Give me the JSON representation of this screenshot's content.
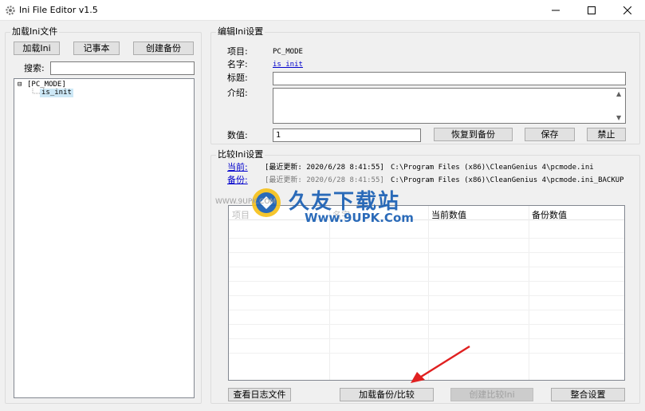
{
  "window": {
    "title": "Ini File Editor v1.5",
    "icon": "gear-icon"
  },
  "left_panel": {
    "group_title": "加载Ini文件",
    "buttons": {
      "load_ini": "加载Ini",
      "notepad": "记事本",
      "create_backup": "创建备份"
    },
    "search_label": "搜索:",
    "search_value": "",
    "tree": {
      "root": "[PC_MODE]",
      "root_toggle": "⊟",
      "child": "is_init"
    }
  },
  "edit_panel": {
    "group_title": "编辑Ini设置",
    "item_label": "项目:",
    "item_value": "PC_MODE",
    "name_label": "名字:",
    "name_value": "is_init",
    "title_label": "标题:",
    "title_value": "",
    "intro_label": "介绍:",
    "intro_value": "",
    "value_label": "数值:",
    "value_value": "1",
    "buttons": {
      "restore": "恢复到备份",
      "save": "保存",
      "disable": "禁止"
    }
  },
  "compare_panel": {
    "group_title": "比较Ini设置",
    "rows": [
      {
        "link": "当前:",
        "updated": "[最近更新: 2020/6/28 8:41:55]",
        "path": "C:\\Program Files (x86)\\CleanGenius 4\\pcmode.ini"
      },
      {
        "link": "备份:",
        "updated": "[最近更新: 2020/6/28 8:41:55]",
        "path": "C:\\Program Files (x86)\\CleanGenius 4\\pcmode.ini_BACKUP"
      }
    ],
    "grid_headers": [
      "项目",
      "名字",
      "当前数值",
      "备份数值"
    ],
    "buttons": {
      "view_log": "查看日志文件",
      "load_backup_compare": "加载备份/比较",
      "create_compare": "创建比较Ini",
      "merge": "整合设置"
    }
  },
  "watermark": {
    "brand": "久友下载站",
    "url": "Www.9UPK.Com",
    "small": "WWW.9UPK.COM"
  },
  "colors": {
    "link": "#0000cc",
    "selection": "#cde8f6",
    "arrow": "#e02020",
    "brand": "#1a5fb4"
  }
}
